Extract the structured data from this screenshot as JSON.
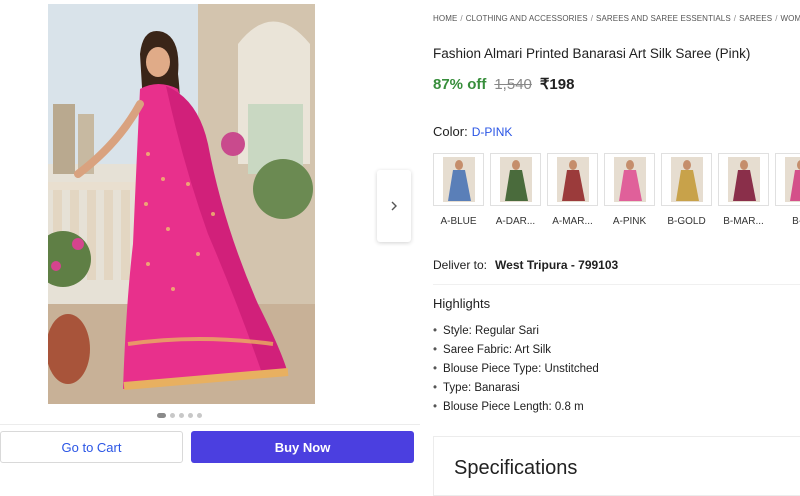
{
  "gallery": {
    "image_alt": "Pink Banarasi art silk saree",
    "next_icon": "chevron-right-icon",
    "dot_count": 5,
    "active_dot": 0
  },
  "actions": {
    "cart_label": "Go to Cart",
    "buy_label": "Buy Now"
  },
  "breadcrumb": [
    "HOME",
    "CLOTHING AND ACCESSORIES",
    "SAREES AND SAREE ESSENTIALS",
    "SAREES",
    "WOME"
  ],
  "product": {
    "title": "Fashion Almari Printed Banarasi Art Silk Saree (Pink)",
    "discount": "87% off",
    "mrp": "1,540",
    "price": "₹198"
  },
  "color": {
    "label": "Color:",
    "selected": "D-PINK",
    "swatches": [
      {
        "label": "A-BLUE",
        "color": "#5a7fb8"
      },
      {
        "label": "A-DAR...",
        "color": "#4a6b3c"
      },
      {
        "label": "A-MAR...",
        "color": "#9b3b3b"
      },
      {
        "label": "A-PINK",
        "color": "#e0609a"
      },
      {
        "label": "B-GOLD",
        "color": "#c8a24a"
      },
      {
        "label": "B-MAR...",
        "color": "#8a2f4a"
      },
      {
        "label": "B-P",
        "color": "#d4508a"
      }
    ]
  },
  "delivery": {
    "label": "Deliver to:",
    "location": "West Tripura - 799103"
  },
  "highlights": {
    "heading": "Highlights",
    "items": [
      "Style: Regular Sari",
      "Saree Fabric: Art Silk",
      "Blouse Piece Type: Unstitched",
      "Type: Banarasi",
      "Blouse Piece Length: 0.8 m"
    ]
  },
  "specifications": {
    "heading": "Specifications"
  },
  "colors": {
    "accent_blue": "#2a55e5",
    "buy_button": "#4b3fe0",
    "discount_green": "#388e3c",
    "saree_pink": "#e8308c"
  }
}
